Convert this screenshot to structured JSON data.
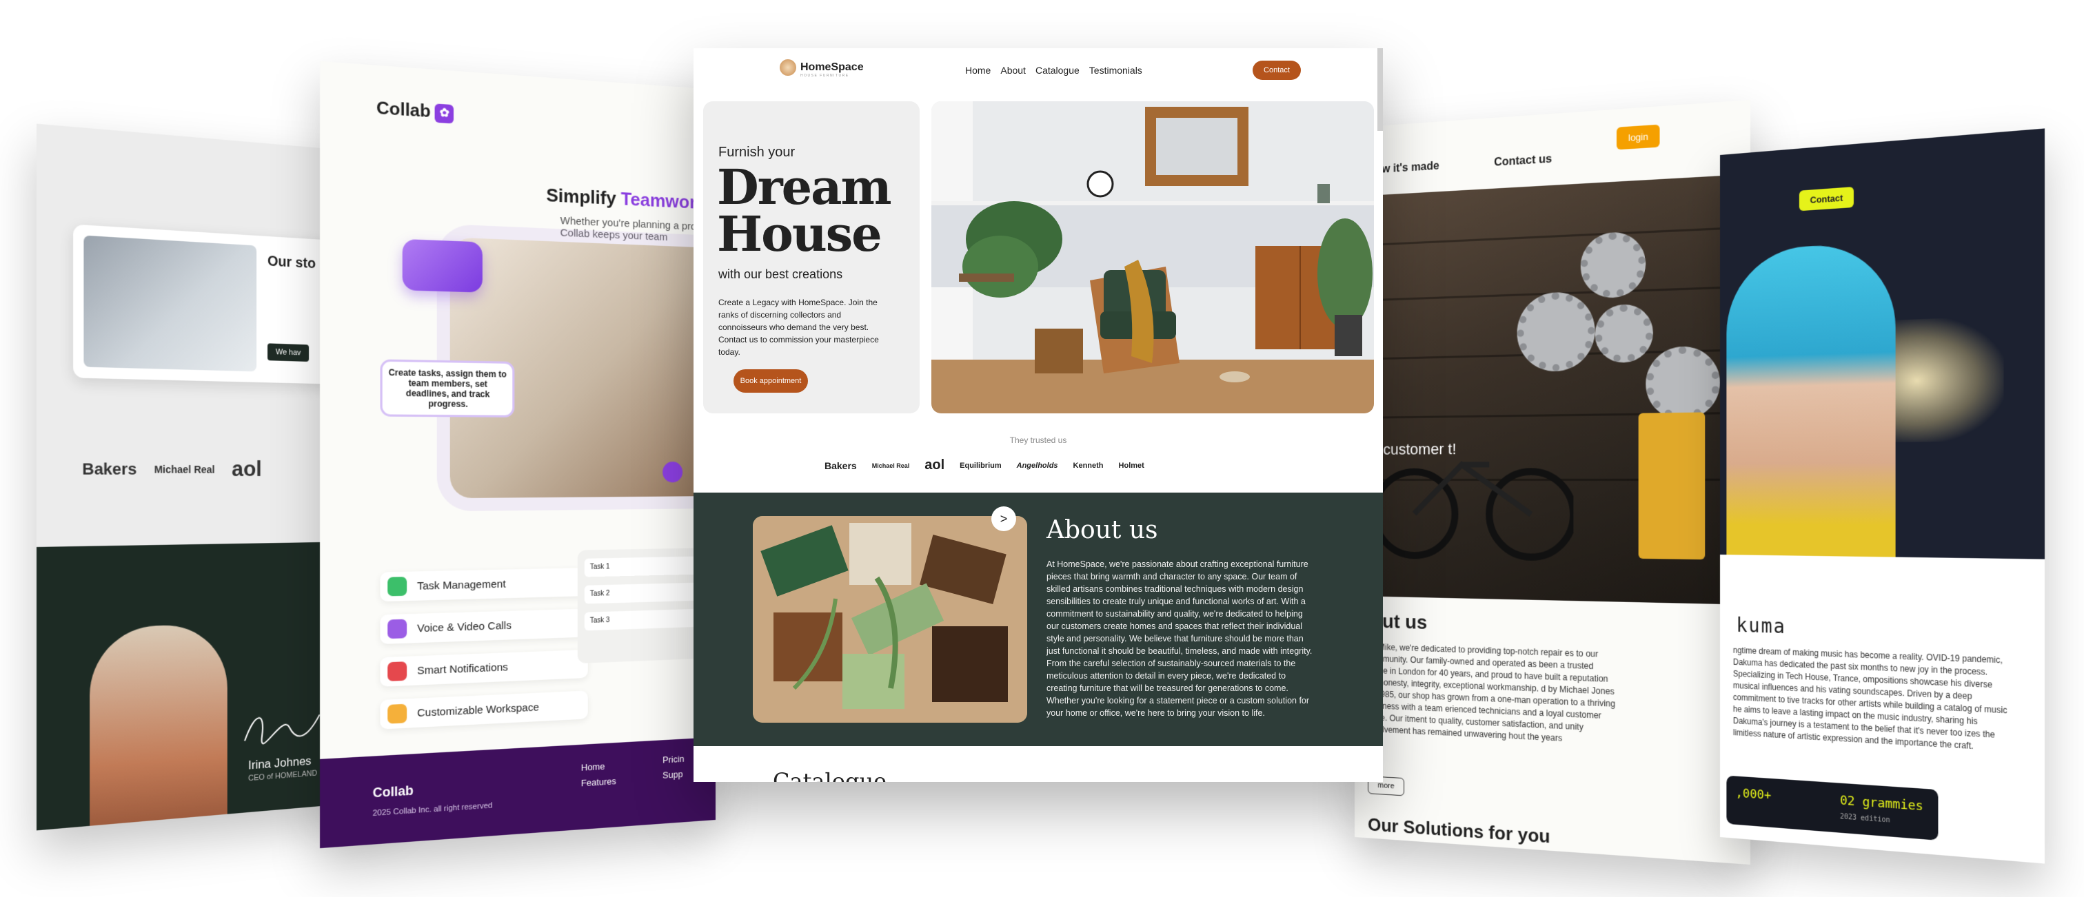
{
  "card1": {
    "story_title": "Our sto",
    "story_button": "We hav",
    "logos": [
      "Bakers",
      "Michael Real",
      "aol"
    ],
    "ceo_name": "Irina Johnes",
    "ceo_role": "CEO of HOMELAND"
  },
  "card2": {
    "logo": "Collab",
    "title_prefix": "Simplify ",
    "title_highlight": "Teamwork.",
    "subtitle": "Whether you're planning a proj Collab keeps your team",
    "bubble": "Create tasks, assign them to team members, set deadlines, and track progress.",
    "features": [
      "Task Management",
      "Voice & Video Calls",
      "Smart Notifications",
      "Customizable Workspace"
    ],
    "tasks": [
      "Task 1",
      "Task 2",
      "Task 3"
    ],
    "footer_logo": "Collab",
    "footer_copy": "2025 Collab Inc. all right reserved",
    "footer_nav": [
      "Home",
      "Features"
    ],
    "footer_nav2": [
      "Pricin",
      "Supp"
    ],
    "colors": {
      "accent": "#8b3fe0",
      "footer": "#3e0f5c"
    }
  },
  "card3": {
    "brand": "HomeSpace",
    "brand_tag": "HOUSE FURNITURE",
    "nav": [
      "Home",
      "About",
      "Catalogue",
      "Testimonials"
    ],
    "contact": "Contact",
    "furnish": "Furnish your",
    "dream_line1": "Dream",
    "dream_line2": "House",
    "with_best": "with our best creations",
    "description": "Create a Legacy with HomeSpace. Join the ranks of discerning collectors and connoisseurs who demand the very best. Contact us to commission your masterpiece today.",
    "book": "Book appointment",
    "trusted": "They trusted us",
    "logos": [
      "Bakers",
      "Michael Real",
      "aol",
      "Equilibrium",
      "Angelholds",
      "Kenneth",
      "Holmet"
    ],
    "about_title": "About us",
    "about_text": "At HomeSpace, we're passionate about crafting exceptional furniture pieces that bring warmth and character to any space. Our team of skilled artisans combines traditional techniques with modern design sensibilities to create truly unique and functional works of art. With a commitment to sustainability and quality, we're dedicated to helping our customers create homes and spaces that reflect their individual style and personality. We believe that furniture should be more than just functional it should be beautiful, timeless, and made with integrity. From the careful selection of sustainably-sourced materials to the meticulous attention to detail in every piece, we're dedicated to creating furniture that will be treasured for generations to come. Whether you're looking for a statement piece or a custom solution for your home or office, we're here to bring your vision to life.",
    "arrow": ">",
    "catalogue": "Catalogue",
    "colors": {
      "accent": "#b5541c",
      "about_bg": "#2e3d39"
    }
  },
  "card4": {
    "nav": [
      "How it's made",
      "Contact us"
    ],
    "login": "login",
    "hero_text": "al customer t!",
    "about": "out us",
    "text": "dy Mike, we're dedicated to providing top-notch repair es to our community. Our family-owned and operated as been a trusted name in London for 40 years, and proud to have built a reputation for honesty, integrity, exceptional workmanship. d by Michael Jones in 1985, our shop has grown from a one-man operation to a thriving business with a team erienced technicians and a loyal customer base. Our itment to quality, customer satisfaction, and unity involvement has remained unwavering hout the years",
    "more": "more",
    "solutions": "Our Solutions for you"
  },
  "card5": {
    "contact": "Contact",
    "title": "kuma",
    "text": "ngtime dream of making music has become a reality. OVID-19 pandemic, Dakuma has dedicated the past six months to new joy in the process. Specializing in Tech House, Trance, ompositions showcase his diverse musical influences and his vating soundscapes. Driven by a deep commitment to tive tracks for other artists while building a catalog of music he aims to leave a lasting impact on the music industry, sharing his Dakuma's journey is a testament to the belief that it's never too izes the limitless nature of artistic expression and the importance the craft.",
    "stat1": ",000+",
    "stat2": "02 grammies",
    "stat2_sub": "2023 edition",
    "colors": {
      "accent": "#e5f21a"
    }
  }
}
